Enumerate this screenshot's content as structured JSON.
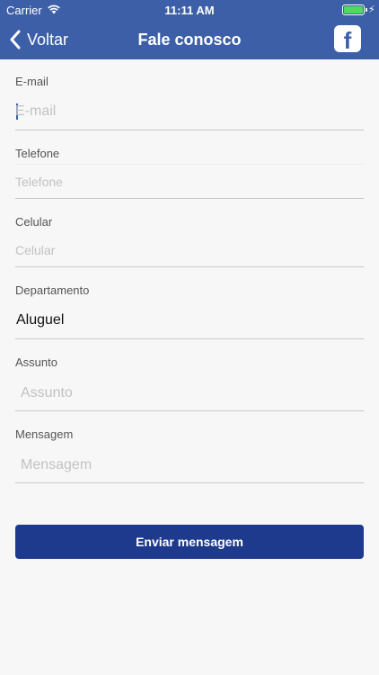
{
  "status_bar": {
    "carrier": "Carrier",
    "time": "11:11 AM"
  },
  "navbar": {
    "back_label": "Voltar",
    "title": "Fale conosco",
    "facebook_glyph": "f"
  },
  "form": {
    "email": {
      "label": "E-mail",
      "placeholder": "E-mail",
      "value": ""
    },
    "telefone": {
      "label": "Telefone",
      "placeholder": "Telefone",
      "value": ""
    },
    "celular": {
      "label": "Celular",
      "placeholder": "Celular",
      "value": ""
    },
    "departamento": {
      "label": "Departamento",
      "value": "Aluguel"
    },
    "assunto": {
      "label": "Assunto",
      "placeholder": "Assunto",
      "value": ""
    },
    "mensagem": {
      "label": "Mensagem",
      "placeholder": "Mensagem",
      "value": ""
    },
    "submit_label": "Enviar mensagem"
  },
  "colors": {
    "header": "#3c5fa8",
    "button": "#1d3a8c",
    "battery": "#4cd964"
  }
}
